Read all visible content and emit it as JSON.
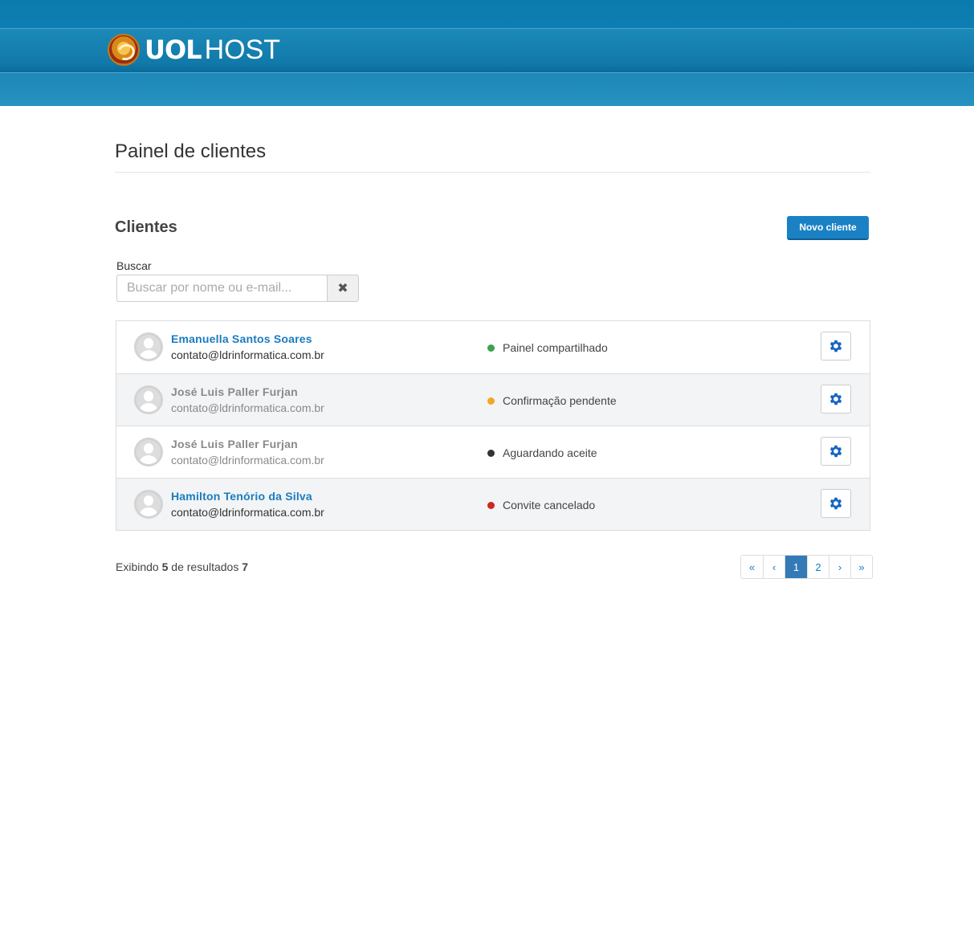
{
  "header": {
    "logo_word": "UOL",
    "logo_suffix": "HOST"
  },
  "page_title": "Painel de clientes",
  "section_title": "Clientes",
  "new_client_button": "Novo cliente",
  "search": {
    "label": "Buscar",
    "placeholder": "Buscar por nome ou e-mail...",
    "value": "",
    "clear_icon": "✖"
  },
  "clients": [
    {
      "name": "Emanuella Santos Soares",
      "email": "contato@ldrinformatica.com.br",
      "status": "Painel compartilhado",
      "status_color": "#3ca34a",
      "muted": false
    },
    {
      "name": "José Luis Paller Furjan",
      "email": "contato@ldrinformatica.com.br",
      "status": "Confirmação pendente",
      "status_color": "#f5a623",
      "muted": true
    },
    {
      "name": "José Luis Paller Furjan",
      "email": "contato@ldrinformatica.com.br",
      "status": "Aguardando aceite",
      "status_color": "#333333",
      "muted": true
    },
    {
      "name": "Hamilton Tenório da Silva",
      "email": "contato@ldrinformatica.com.br",
      "status": "Convite cancelado",
      "status_color": "#d0271f",
      "muted": false
    }
  ],
  "results": {
    "prefix": "Exibindo",
    "shown": "5",
    "middle": "de resultados",
    "total": "7"
  },
  "pagination": {
    "first": "«",
    "prev": "‹",
    "pages": [
      "1",
      "2"
    ],
    "active_page": "1",
    "next": "›",
    "last": "»"
  },
  "colors": {
    "accent": "#1a82c4",
    "link": "#1a7cc0",
    "gear": "#1565c0"
  }
}
